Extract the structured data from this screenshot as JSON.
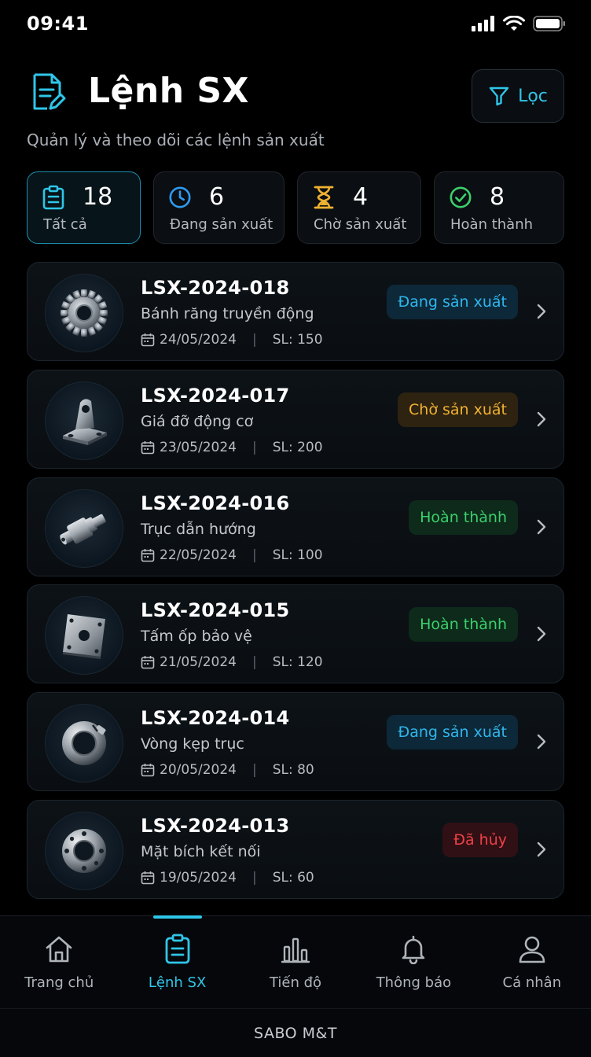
{
  "status_bar": {
    "time": "09:41"
  },
  "header": {
    "title": "Lệnh SX",
    "filter_label": "Lọc",
    "subtitle": "Quản lý và theo dõi các lệnh sản xuất"
  },
  "stats": [
    {
      "count": "18",
      "label": "Tất cả",
      "icon": "clipboard-icon",
      "color": "#2fc6e8"
    },
    {
      "count": "6",
      "label": "Đang sản xuất",
      "icon": "clock-icon",
      "color": "#2f9bf0"
    },
    {
      "count": "4",
      "label": "Chờ sản xuất",
      "icon": "hourglass-icon",
      "color": "#f0b232"
    },
    {
      "count": "8",
      "label": "Hoàn thành",
      "icon": "check-circle-icon",
      "color": "#3ccf6c"
    }
  ],
  "orders": [
    {
      "code": "LSX-2024-018",
      "name": "Bánh răng truyền động",
      "date": "24/05/2024",
      "qty": "SL: 150",
      "status": "Đang sản xuất",
      "status_color": "blue",
      "icon": "gear-part-icon"
    },
    {
      "code": "LSX-2024-017",
      "name": "Giá đỡ động cơ",
      "date": "23/05/2024",
      "qty": "SL: 200",
      "status": "Chờ sản xuất",
      "status_color": "orange",
      "icon": "bracket-part-icon"
    },
    {
      "code": "LSX-2024-016",
      "name": "Trục dẫn hướng",
      "date": "22/05/2024",
      "qty": "SL: 100",
      "status": "Hoàn thành",
      "status_color": "green",
      "icon": "shaft-part-icon"
    },
    {
      "code": "LSX-2024-015",
      "name": "Tấm ốp bảo vệ",
      "date": "21/05/2024",
      "qty": "SL: 120",
      "status": "Hoàn thành",
      "status_color": "green",
      "icon": "plate-part-icon"
    },
    {
      "code": "LSX-2024-014",
      "name": "Vòng kẹp trục",
      "date": "20/05/2024",
      "qty": "SL: 80",
      "status": "Đang sản xuất",
      "status_color": "blue",
      "icon": "clamp-ring-part-icon"
    },
    {
      "code": "LSX-2024-013",
      "name": "Mặt bích kết nối",
      "date": "19/05/2024",
      "qty": "SL: 60",
      "status": "Đã hủy",
      "status_color": "red",
      "icon": "flange-part-icon"
    }
  ],
  "nav": [
    {
      "label": "Trang chủ",
      "icon": "home-icon"
    },
    {
      "label": "Lệnh SX",
      "icon": "clipboard-icon",
      "active": true
    },
    {
      "label": "Tiến độ",
      "icon": "bar-chart-icon"
    },
    {
      "label": "Thông báo",
      "icon": "bell-icon"
    },
    {
      "label": "Cá nhân",
      "icon": "user-icon"
    }
  ],
  "footer": {
    "brand": "SABO M&T"
  },
  "colors": {
    "accent": "#2fc6e8",
    "background": "#000000"
  }
}
